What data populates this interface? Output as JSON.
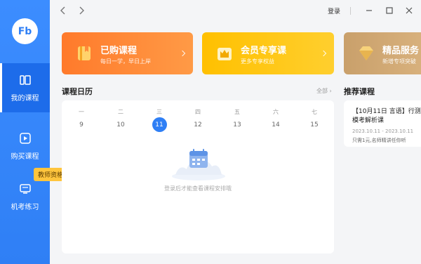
{
  "app": {
    "logo_text": "Fb"
  },
  "sidebar": {
    "items": [
      {
        "label": "我的课程",
        "icon": "book-icon",
        "active": true
      },
      {
        "label": "购买课程",
        "icon": "play-icon",
        "active": false
      },
      {
        "label": "机考练习",
        "icon": "exam-icon",
        "active": false
      }
    ],
    "tooltip": "教师资格证"
  },
  "topbar": {
    "login_label": "登录"
  },
  "cards": [
    {
      "title": "已购课程",
      "subtitle": "每日一学，早日上岸",
      "icon": "book-icon",
      "color": "#ff8a3a"
    },
    {
      "title": "会员专享课",
      "subtitle": "更多专享权益",
      "icon": "crown-icon",
      "color": "#ffc515"
    },
    {
      "title": "精品服务",
      "subtitle": "新增专项突破",
      "icon": "diamond-icon",
      "color": "#d1a873"
    }
  ],
  "calendar": {
    "title": "课程日历",
    "all_label": "全部",
    "weekdays": [
      "一",
      "二",
      "三",
      "四",
      "五",
      "六",
      "七"
    ],
    "dates": [
      "9",
      "10",
      "11",
      "12",
      "13",
      "14",
      "15"
    ],
    "today_index": 2,
    "empty_text": "登录后才能查看课程安排哦"
  },
  "recommend": {
    "title": "推荐课程",
    "item": {
      "name_line1": "【10月11日 言语】行测",
      "name_line2": "模考解析课",
      "dates": "2023.10.11 - 2023.10.11",
      "price": "只需1元,名师精讲任你听"
    }
  },
  "colors": {
    "primary": "#2f7ff5",
    "sidebar_active": "#1d6cea",
    "tooltip": "#ffc53d"
  }
}
